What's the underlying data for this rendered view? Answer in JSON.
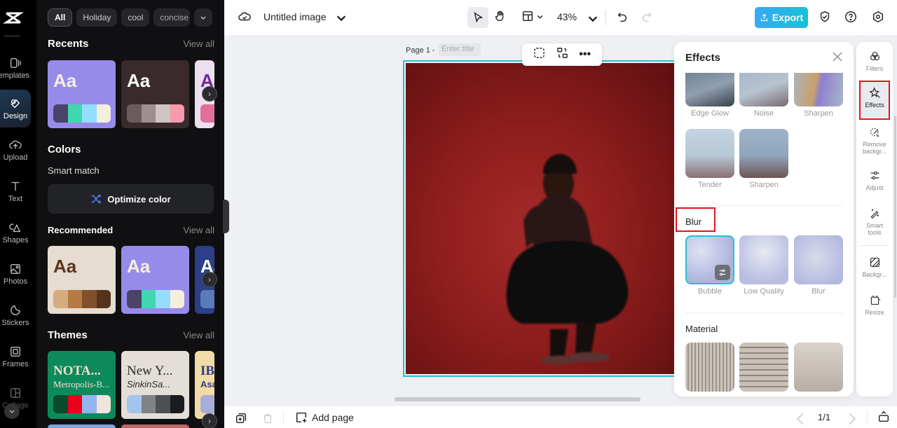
{
  "rail": {
    "items": [
      {
        "label": "Templates",
        "icon": "templates-icon"
      },
      {
        "label": "Design",
        "icon": "design-icon",
        "active": true
      },
      {
        "label": "Upload",
        "icon": "upload-icon"
      },
      {
        "label": "Text",
        "icon": "text-icon"
      },
      {
        "label": "Shapes",
        "icon": "shapes-icon"
      },
      {
        "label": "Photos",
        "icon": "photos-icon"
      },
      {
        "label": "Stickers",
        "icon": "stickers-icon"
      },
      {
        "label": "Frames",
        "icon": "frames-icon"
      },
      {
        "label": "Collage",
        "icon": "collage-icon"
      }
    ]
  },
  "side": {
    "chips": [
      "All",
      "Holiday",
      "cool",
      "concise"
    ],
    "recents": {
      "title": "Recents",
      "view_all": "View all"
    },
    "colors": {
      "title": "Colors",
      "smart_match": "Smart match",
      "optimize": "Optimize color"
    },
    "recommended": {
      "title": "Recommended",
      "view_all": "View all"
    },
    "themes": {
      "title": "Themes",
      "view_all": "View all",
      "items": [
        {
          "t1": "NOTA...",
          "t2": "Metropolis-B..."
        },
        {
          "t1": "New Y...",
          "t2": "SinkinSa..."
        },
        {
          "t1": "IB",
          "t2": "Asa"
        }
      ]
    },
    "card_text": "Aa",
    "palettes": {
      "recent1": {
        "bg": "#978bea",
        "fg": "#f3efdc",
        "colors": [
          "#4a4468",
          "#3fd7b0",
          "#96dcff",
          "#f3efdc"
        ]
      },
      "recent2": {
        "bg": "#3a2a2b",
        "fg": "#ffffff",
        "colors": [
          "#6a5c5e",
          "#9d8f90",
          "#cfc3c4",
          "#f69aae"
        ]
      },
      "recent3": {
        "bg": "#eedff0",
        "fg": "#6b2b9a",
        "colors": [
          "#e06f9b"
        ]
      },
      "rec1": {
        "bg": "#e6dcd0",
        "fg": "#5b3520",
        "colors": [
          "#d6ab7f",
          "#b77a45",
          "#81502a",
          "#53331e"
        ]
      },
      "rec2": {
        "bg": "#978bea",
        "fg": "#f3efdc",
        "colors": [
          "#4a4468",
          "#3fd7b0",
          "#96dcff",
          "#f3efdc"
        ]
      },
      "rec3": {
        "bg": "#2c3f88",
        "fg": "#ffffff",
        "colors": [
          "#5a7ab8"
        ]
      },
      "th1": {
        "bg": "#0d8a5c",
        "fg": "#f6ddd0",
        "colors": [
          "#0a4a2c",
          "#e9001c",
          "#92b4ef",
          "#f3e3da"
        ]
      },
      "th2": {
        "bg": "#e3dfd8",
        "fg": "#2a2a2a",
        "colors": [
          "#a1c5ef",
          "#808384",
          "#4c4f54",
          "#1b1c1f"
        ]
      },
      "th3": {
        "bg": "#f1dba7",
        "fg": "#2e3a8f",
        "colors": [
          "#a8acd9"
        ]
      }
    }
  },
  "topbar": {
    "title": "Untitled image",
    "zoom": "43%",
    "export": "Export"
  },
  "canvas": {
    "page_label": "Page 1 -",
    "title_placeholder": "Enter title"
  },
  "effects": {
    "title": "Effects",
    "row1": [
      "Edge Glow",
      "Noise",
      "Sharpen"
    ],
    "row2": [
      "Tender",
      "Sharpen"
    ],
    "blur_title": "Blur",
    "blur": [
      "Bubble",
      "Low Quality",
      "Blur"
    ],
    "material_title": "Material"
  },
  "right_tools": [
    {
      "label": "Filters"
    },
    {
      "label": "Effects",
      "active": true
    },
    {
      "label": "Remove backgr..."
    },
    {
      "label": "Adjust"
    },
    {
      "label": "Smart tools"
    },
    {
      "label": "Backgr..."
    },
    {
      "label": "Resize"
    }
  ],
  "bottombar": {
    "add_page": "Add page",
    "page_count": "1/1"
  },
  "colors": {
    "accent": "#21c2d9",
    "highlight": "#e0141e"
  }
}
